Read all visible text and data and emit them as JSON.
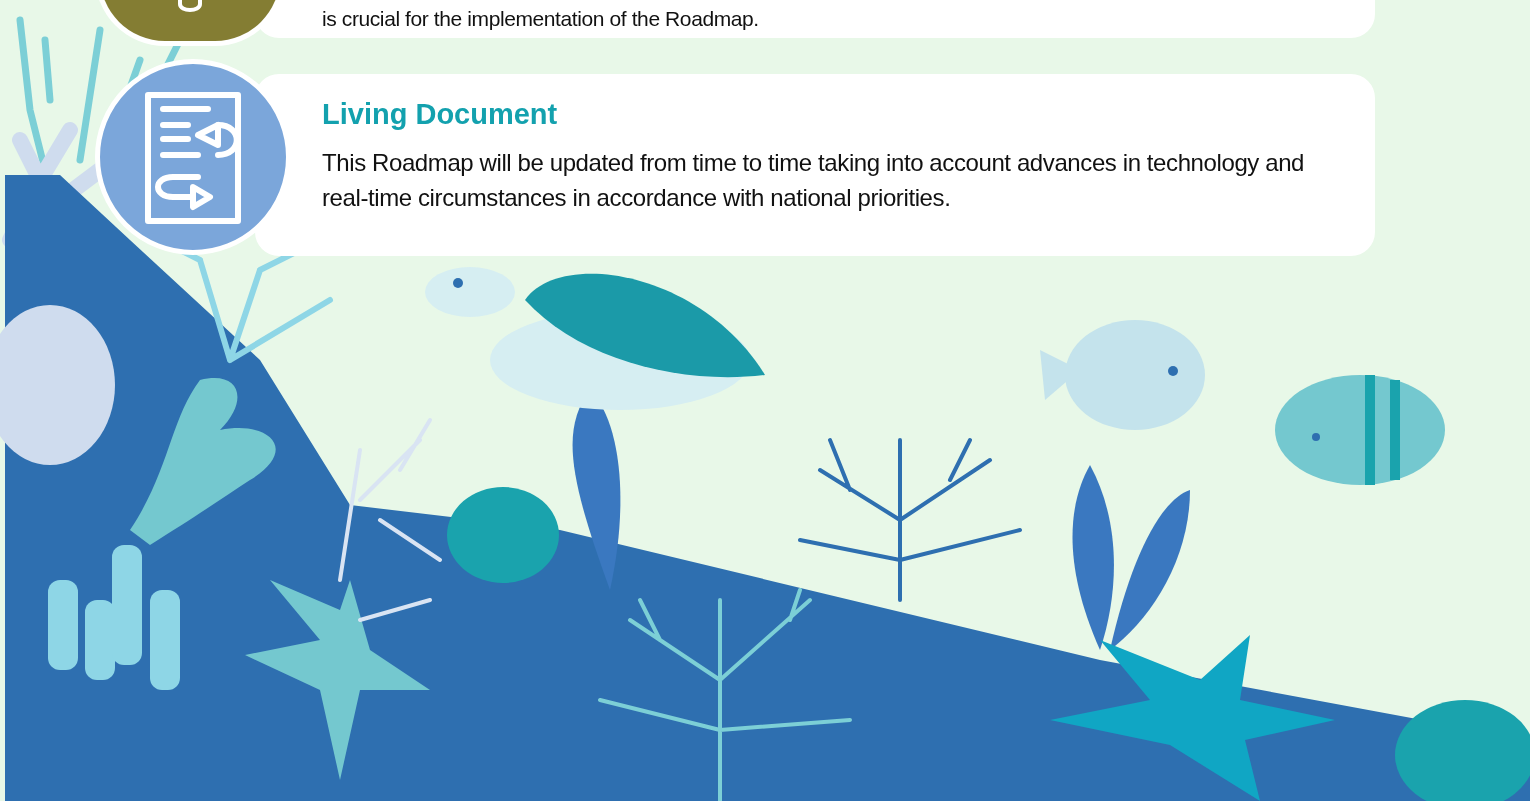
{
  "sections": [
    {
      "kind": "cut",
      "text": "is crucial for the implementation of the Roadmap."
    },
    {
      "kind": "full",
      "title": "Living Document",
      "text": "This Roadmap will be updated from time to time taking into account advances in technology and real-time circumstances in accordance with national priorities."
    }
  ]
}
